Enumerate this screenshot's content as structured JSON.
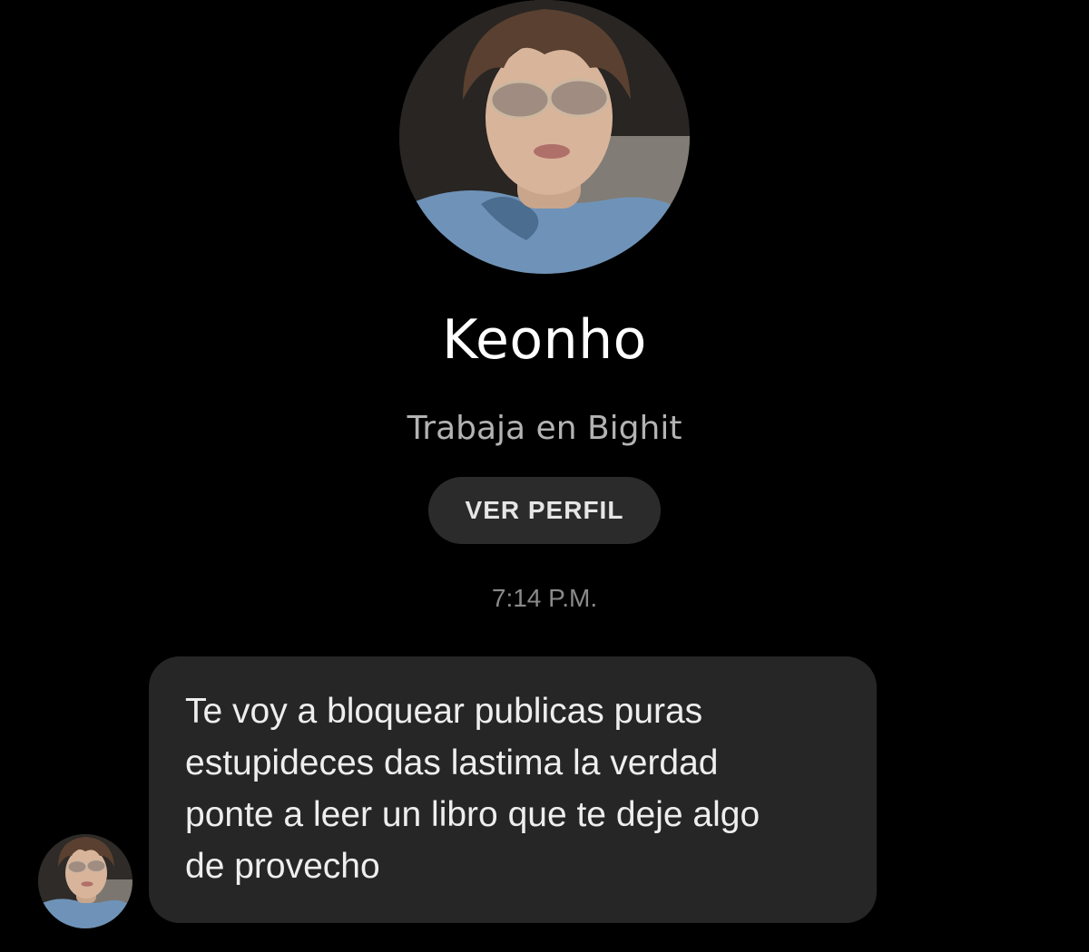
{
  "contact": {
    "name": "Keonho",
    "subtitle": "Trabaja en Bighit",
    "view_profile_label": "VER PERFIL",
    "avatar_icon": "profile-photo"
  },
  "conversation": {
    "timestamp": "7:14 P.M.",
    "messages": [
      {
        "direction": "incoming",
        "text": "Te voy a bloquear publicas puras\nestupideces das lastima  la verdad\nponte a leer un libro que te deje algo\nde provecho"
      }
    ]
  },
  "colors": {
    "background": "#000000",
    "bubble": "#262626",
    "button": "#2b2b2b",
    "subtitle": "#b3b3b3",
    "timestamp": "#8a8a8a"
  }
}
